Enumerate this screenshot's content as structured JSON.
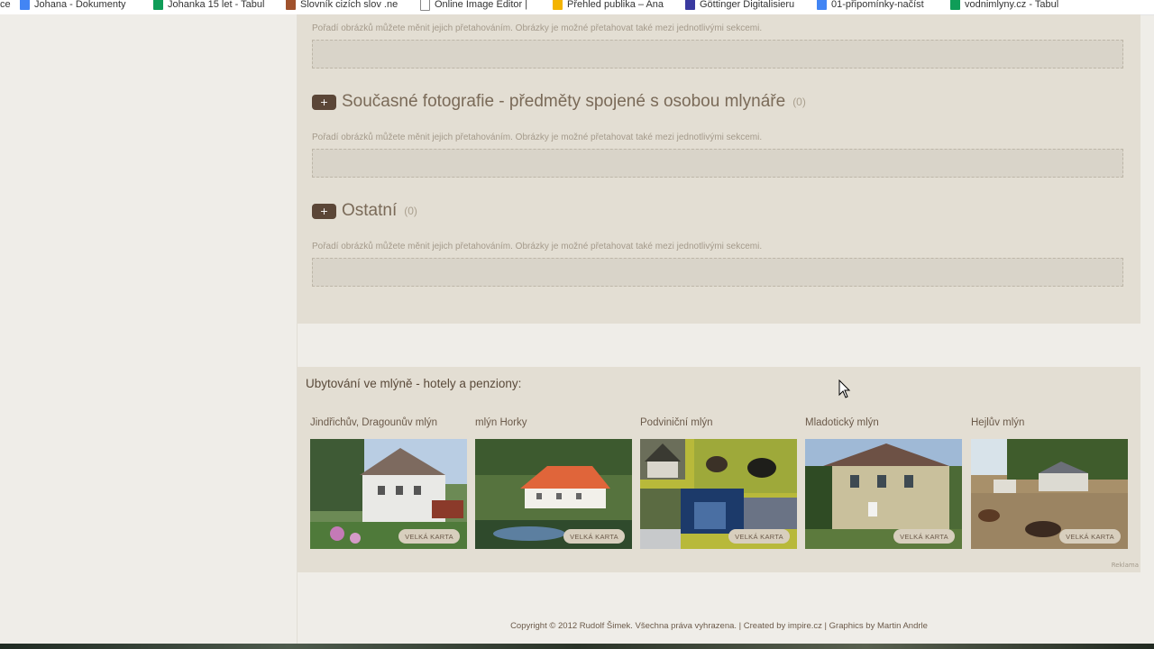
{
  "bookmarks": [
    {
      "label": "ce",
      "icon": "none-icon"
    },
    {
      "label": "Johana - Dokumenty",
      "icon": "docs-icon"
    },
    {
      "label": "Johanka 15 let - Tabul",
      "icon": "sheets-icon"
    },
    {
      "label": "Slovník cizích slov .ne",
      "icon": "book-icon"
    },
    {
      "label": "Online Image Editor |",
      "icon": "page-icon"
    },
    {
      "label": "Přehled publika – Ana",
      "icon": "analytics-icon"
    },
    {
      "label": "Göttinger Digitalisieru",
      "icon": "goettingen-icon"
    },
    {
      "label": "01-připomínky-načíst",
      "icon": "docs-icon"
    },
    {
      "label": "vodnimlyny.cz - Tabul",
      "icon": "sheets-icon"
    }
  ],
  "sections": {
    "hint_text": "Pořadí obrázků můžete měnit jejich přetahováním. Obrázky je možné přetahovat také mezi jednotlivými sekcemi.",
    "plus_label": "+",
    "items": [
      {
        "title": "Současné fotografie - předměty spojené s osobou mlynáře",
        "count": "(0)"
      },
      {
        "title": "Ostatní",
        "count": "(0)"
      }
    ]
  },
  "accommodation": {
    "title": "Ubytování ve mlýně - hotely a penziony:",
    "button_label": "VELKÁ KARTA",
    "ads_label": "Reklama",
    "cards": [
      {
        "name": "Jindřichův, Dragounův mlýn"
      },
      {
        "name": "mlýn Horky"
      },
      {
        "name": "Podviniční mlýn"
      },
      {
        "name": "Mladotický mlýn"
      },
      {
        "name": "Hejlův mlýn"
      }
    ]
  },
  "footer": {
    "text": "Copyright © 2012 Rudolf Šimek. Všechna práva vyhrazena. | Created by impire.cz | Graphics by Martin Andrle"
  }
}
